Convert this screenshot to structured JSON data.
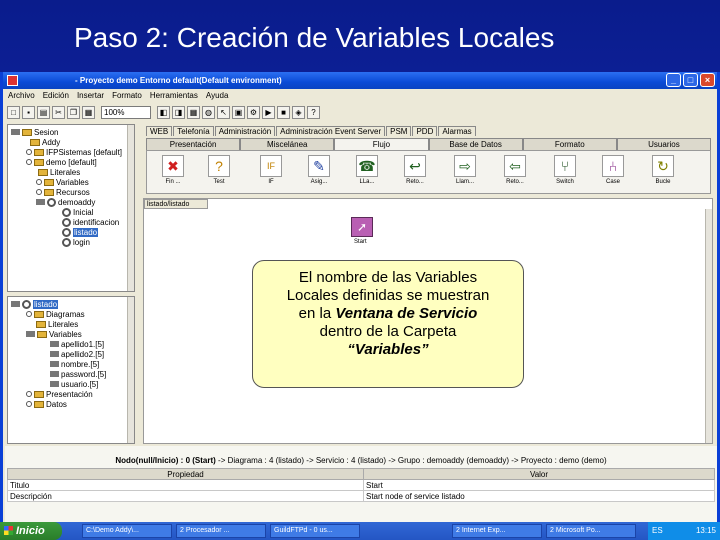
{
  "slide": {
    "title": "Paso 2: Creación de Variables Locales"
  },
  "window": {
    "title": "- Proyecto demo Entorno default(Default environment)",
    "controls": [
      "_",
      "□",
      "×"
    ]
  },
  "menu": [
    "Archivo",
    "Edición",
    "Insertar",
    "Formato",
    "Herramientas",
    "Ayuda"
  ],
  "toolbar": {
    "zoom": "100%"
  },
  "tree_top": {
    "nodes": [
      "Sesion",
      "Addy",
      "IFPSistemas [default]",
      "demo [default]",
      "Literales",
      "Variables",
      "Recursos",
      "demoaddy",
      "Inicial",
      "identificacion",
      "listado",
      "login"
    ]
  },
  "tree_bottom": {
    "nodes": [
      "listado",
      "Diagramas",
      "Literales",
      "Variables",
      "apellido1.[5]",
      "apellido2.[5]",
      "nombre.[5]",
      "password.[5]",
      "usuario.[5]",
      "Presentación",
      "Datos"
    ]
  },
  "tabs_top": [
    "WEB",
    "Telefonía",
    "Administración",
    "Administración Event Server",
    "PSM",
    "PDD",
    "Alarmas"
  ],
  "tabs_bottom": [
    "Presentación",
    "Miscelánea",
    "Flujo",
    "Base de Datos",
    "Formato",
    "Usuarios"
  ],
  "palette": [
    {
      "label": "Fin ...",
      "icon": "✖",
      "color": "#d02020"
    },
    {
      "label": "Test",
      "icon": "?",
      "color": "#c08000"
    },
    {
      "label": "IF",
      "icon": "IF",
      "color": "#c08000"
    },
    {
      "label": "Asig...",
      "icon": "✎",
      "color": "#2040a0"
    },
    {
      "label": "LLa...",
      "icon": "☎",
      "color": "#206020"
    },
    {
      "label": "Reto...",
      "icon": "↩",
      "color": "#206020"
    },
    {
      "label": "Llam...",
      "icon": "⇨",
      "color": "#206020"
    },
    {
      "label": "Reto...",
      "icon": "⇦",
      "color": "#206020"
    },
    {
      "label": "Switch",
      "icon": "⑂",
      "color": "#205020"
    },
    {
      "label": "Case",
      "icon": "⑃",
      "color": "#802080"
    },
    {
      "label": "Bucle",
      "icon": "↻",
      "color": "#808000"
    }
  ],
  "canvas": {
    "tab": "listado/listado",
    "start_label": "Start"
  },
  "callout": {
    "line1": "El nombre de las Variables",
    "line2": "Locales definidas se muestran",
    "line3_pre": "en la",
    "line3_em": "Ventana de Servicio",
    "line4": "dentro de la Carpeta",
    "line5": "“Variables”"
  },
  "node_info": {
    "bold": "Nodo(null/Inicio) : 0 (Start)",
    "rest": "-> Diagrama : 4 (listado) -> Servicio : 4 (listado) -> Grupo : demoaddy (demoaddy) -> Proyecto : demo (demo)"
  },
  "properties": {
    "headers": [
      "Propiedad",
      "Valor"
    ],
    "rows": [
      [
        "Titulo",
        "Start"
      ],
      [
        "Descripción",
        "Start node of service listado"
      ]
    ]
  },
  "taskbar": {
    "start": "Inicio",
    "tasks": [
      "C:\\Demo Addy\\...",
      "2 Procesador ...",
      "GuildFTPd - 0 us...",
      "2 Internet Exp...",
      "2 Microsoft Po..."
    ],
    "lang": "ES",
    "time": "13:15"
  }
}
